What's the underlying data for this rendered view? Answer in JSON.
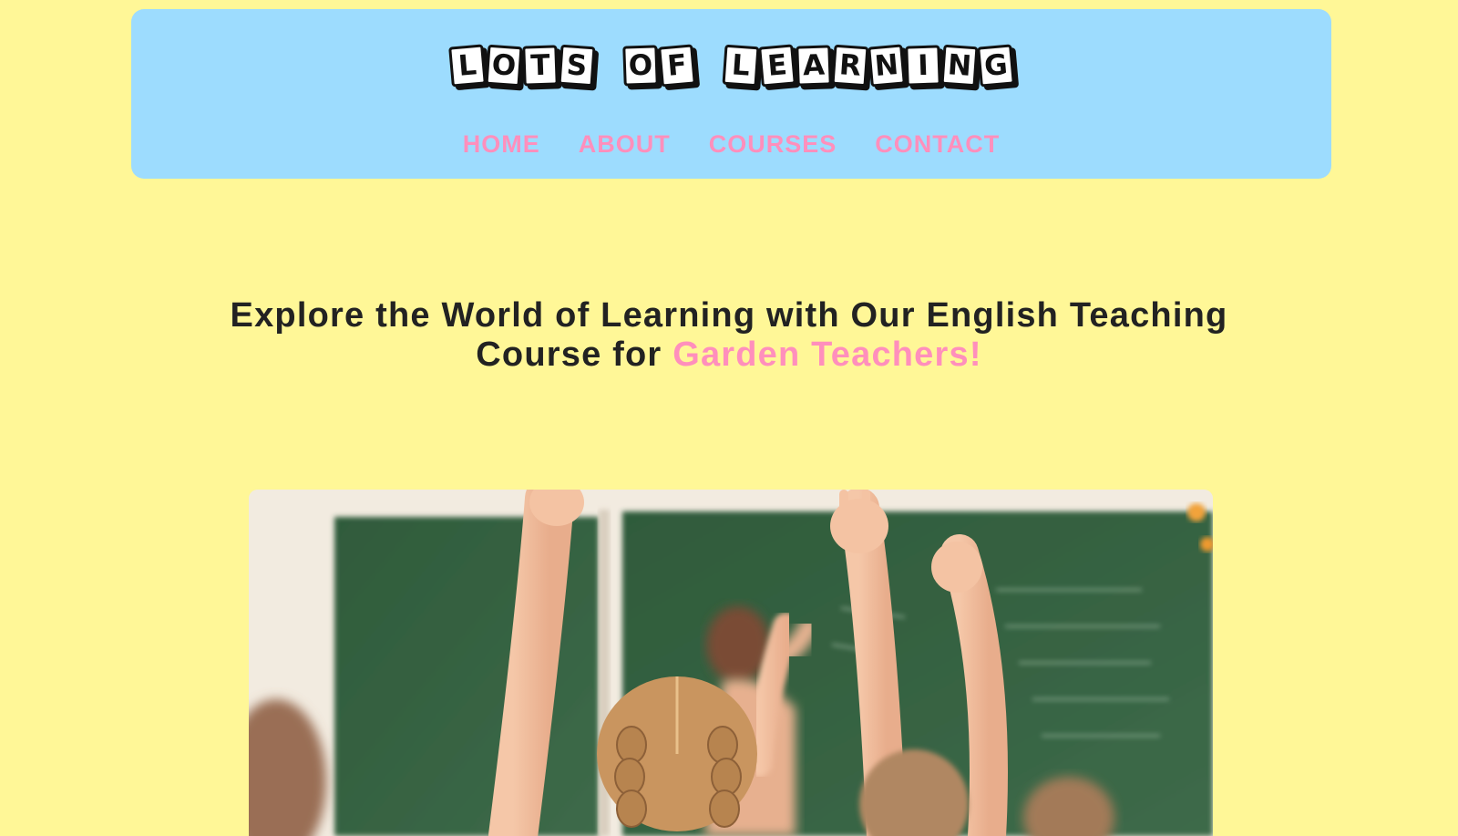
{
  "header": {
    "logo_words": [
      [
        "L",
        "O",
        "T",
        "S"
      ],
      [
        "O",
        "F"
      ],
      [
        "L",
        "E",
        "A",
        "R",
        "N",
        "I",
        "N",
        "G"
      ]
    ],
    "logo_text": "LOTS OF LEARNING",
    "nav": [
      {
        "label": "HOME"
      },
      {
        "label": "ABOUT"
      },
      {
        "label": "COURSES"
      },
      {
        "label": "CONTACT"
      }
    ]
  },
  "hero": {
    "title_main": "Explore the World of Learning with Our English Teaching Course for ",
    "title_accent": "Garden Teachers!"
  },
  "colors": {
    "page_background": "#fff797",
    "header_background": "#9ddcfe",
    "nav_link": "#ff8fbc",
    "accent": "#ff8fbc",
    "title_text": "#222222"
  }
}
